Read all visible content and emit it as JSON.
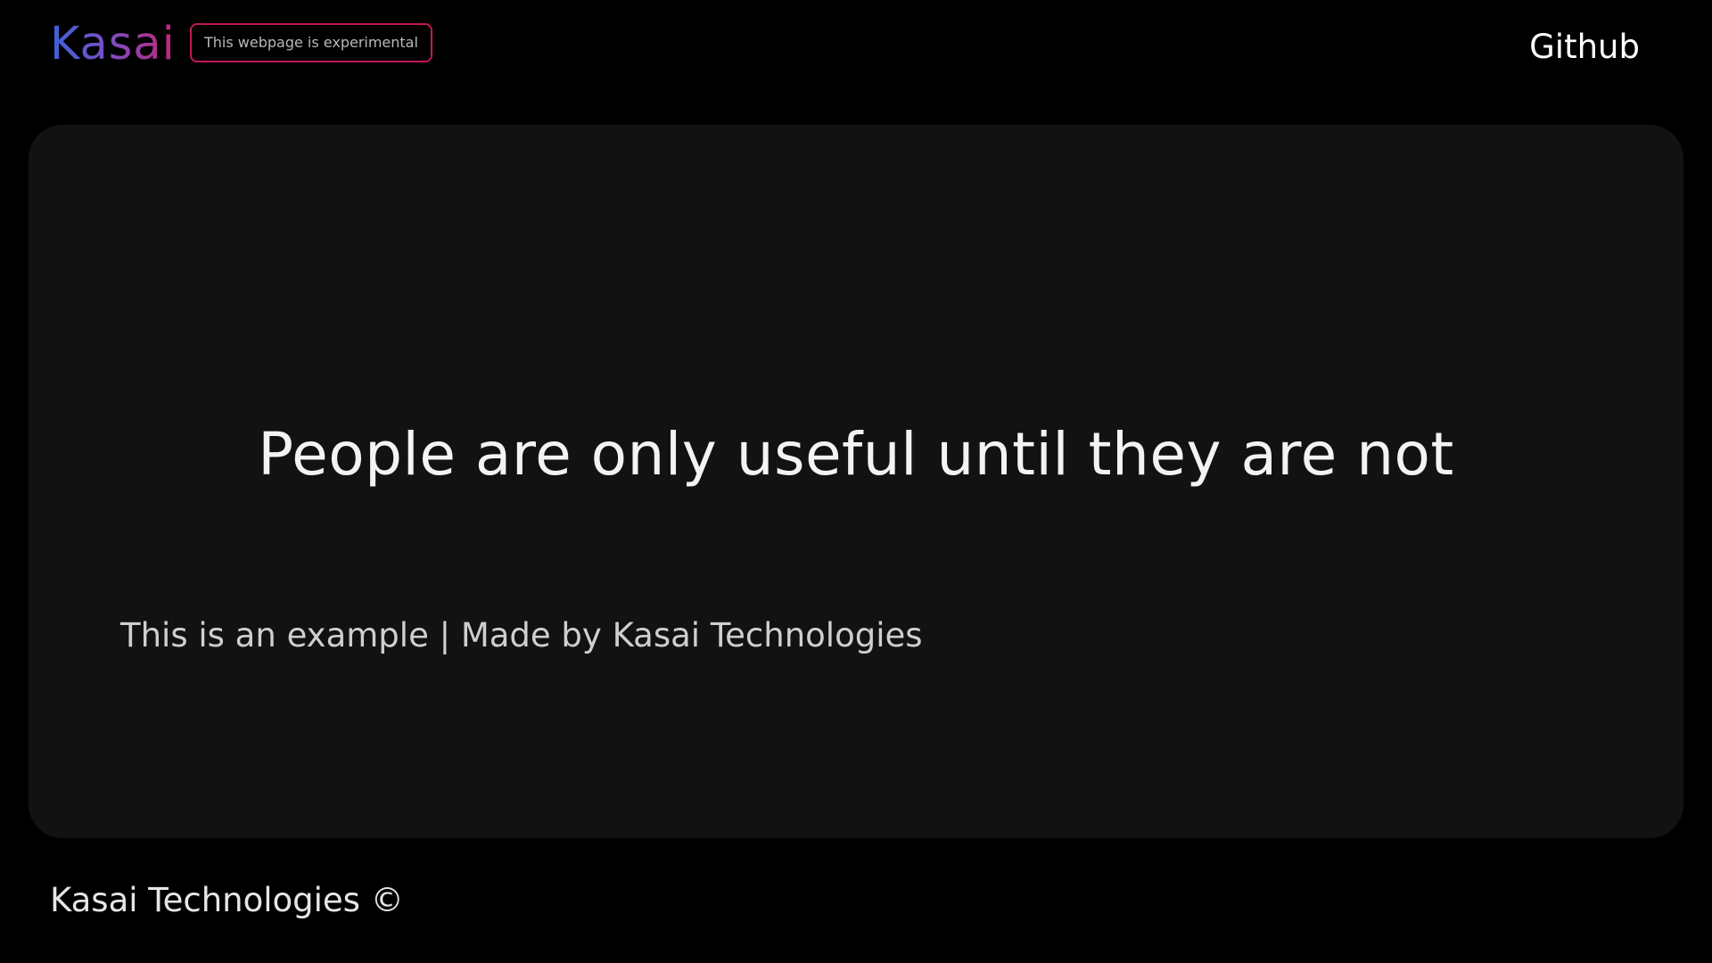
{
  "header": {
    "logo_text": "Kasai",
    "badge_text": "This webpage is experimental",
    "github_label": "Github"
  },
  "hero": {
    "headline": "People are only useful until they are not",
    "subline": "This is an example | Made by Kasai Technologies"
  },
  "footer": {
    "copyright": "Kasai Technologies ©"
  },
  "colors": {
    "background": "#000000",
    "card": "#121212",
    "logo_gradient_start": "#3b63d8",
    "logo_gradient_end": "#c2267a",
    "badge_border": "#c2185b",
    "text_primary": "#ffffff"
  }
}
